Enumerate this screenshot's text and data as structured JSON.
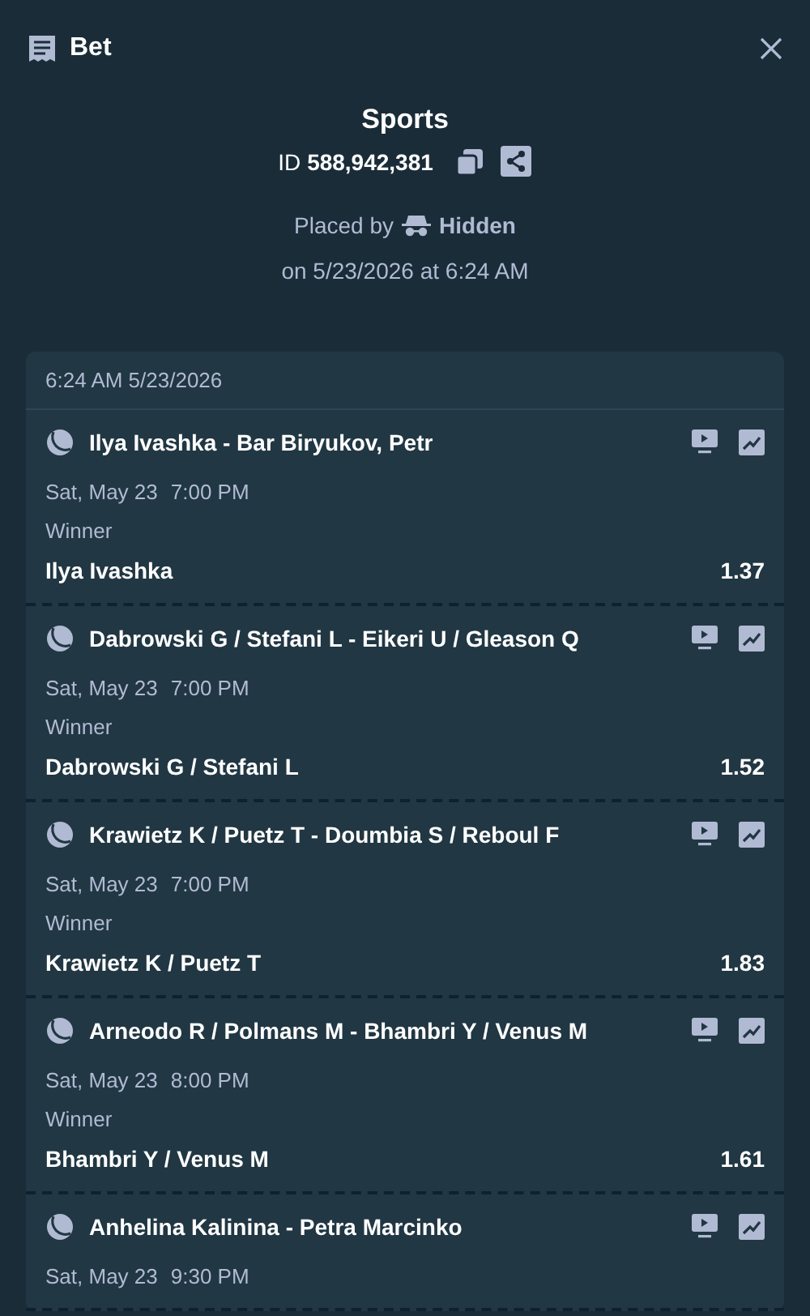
{
  "header": {
    "title": "Bet"
  },
  "summary": {
    "title": "Sports",
    "id_label": "ID",
    "id_value": "588,942,381",
    "placed_by_label": "Placed by",
    "placed_by_user": "Hidden",
    "placed_on": "on 5/23/2026 at 6:24 AM"
  },
  "card": {
    "timestamp": "6:24 AM 5/23/2026",
    "legs": [
      {
        "event": "Ilya Ivashka - Bar Biryukov, Petr",
        "date": "Sat, May 23",
        "time": "7:00 PM",
        "market": "Winner",
        "selection": "Ilya Ivashka",
        "odds": "1.37"
      },
      {
        "event": "Dabrowski G / Stefani L - Eikeri U / Gleason Q",
        "date": "Sat, May 23",
        "time": "7:00 PM",
        "market": "Winner",
        "selection": "Dabrowski G / Stefani L",
        "odds": "1.52"
      },
      {
        "event": "Krawietz K / Puetz T - Doumbia S / Reboul F",
        "date": "Sat, May 23",
        "time": "7:00 PM",
        "market": "Winner",
        "selection": "Krawietz K / Puetz T",
        "odds": "1.83"
      },
      {
        "event": "Arneodo R / Polmans M - Bhambri Y / Venus M",
        "date": "Sat, May 23",
        "time": "8:00 PM",
        "market": "Winner",
        "selection": "Bhambri Y / Venus M",
        "odds": "1.61"
      },
      {
        "event": "Anhelina Kalinina - Petra Marcinko",
        "date": "Sat, May 23",
        "time": "9:30 PM"
      }
    ]
  }
}
